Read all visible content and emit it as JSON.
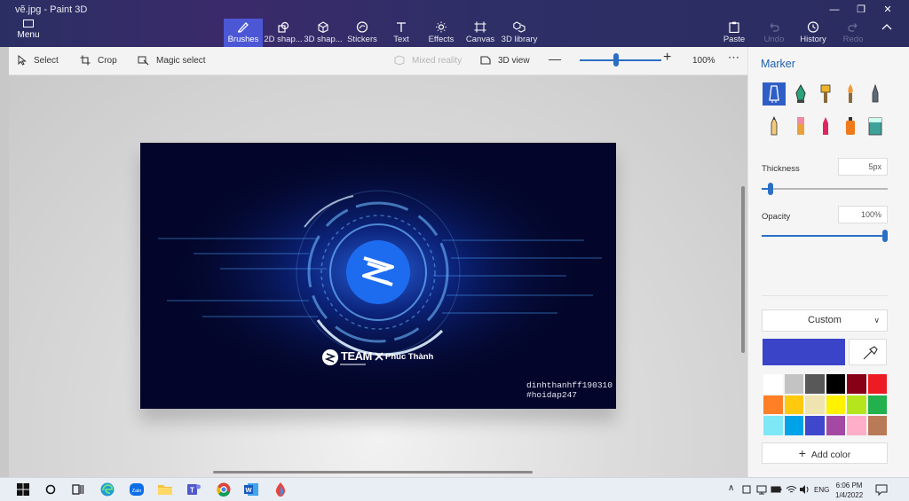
{
  "window": {
    "title": "vẽ.jpg - Paint 3D"
  },
  "ribbon": {
    "menu_label": "Menu",
    "tabs": [
      {
        "label": "Brushes",
        "active": true
      },
      {
        "label": "2D shap..."
      },
      {
        "label": "3D shap..."
      },
      {
        "label": "Stickers"
      },
      {
        "label": "Text"
      },
      {
        "label": "Effects"
      },
      {
        "label": "Canvas"
      },
      {
        "label": "3D library"
      }
    ],
    "right": [
      {
        "label": "Paste",
        "enabled": true
      },
      {
        "label": "Undo",
        "enabled": false
      },
      {
        "label": "History",
        "enabled": true
      },
      {
        "label": "Redo",
        "enabled": false
      }
    ]
  },
  "toolbar": {
    "select": "Select",
    "crop": "Crop",
    "magic_select": "Magic select",
    "mixed_reality": "Mixed reality",
    "view_3d": "3D view",
    "zoom_value": "100%",
    "zoom_level": 0.45
  },
  "canvas_image": {
    "logo_text": "TEAM",
    "collab_text": "Phúc Thành",
    "watermark_line1": "dinhthanhff190310",
    "watermark_line2": "#hoidap247"
  },
  "panel": {
    "title": "Marker",
    "brushes": [
      "marker",
      "calligraphy-pen",
      "oil-brush",
      "watercolor",
      "pixel-pen",
      "pencil",
      "eraser",
      "crayon",
      "spray-can",
      "fill"
    ],
    "thickness_label": "Thickness",
    "thickness_value": "5px",
    "thickness_level": 0.05,
    "opacity_label": "Opacity",
    "opacity_value": "100%",
    "opacity_level": 1.0,
    "color_mode": "Custom",
    "current_color": "#3a44c9",
    "swatches": [
      "#ffffff",
      "#c3c3c3",
      "#585858",
      "#000000",
      "#880015",
      "#ed1c24",
      "#ff7f27",
      "#ffc90e",
      "#efe4b0",
      "#fff200",
      "#b5e61d",
      "#22b14c",
      "#7fe8f7",
      "#00a2e8",
      "#3f48cc",
      "#a349a4",
      "#ffaec9",
      "#b97a57"
    ],
    "add_color": "Add color"
  },
  "taskbar": {
    "lang": "ENG",
    "time": "6:06 PM",
    "date": "1/4/2022"
  }
}
